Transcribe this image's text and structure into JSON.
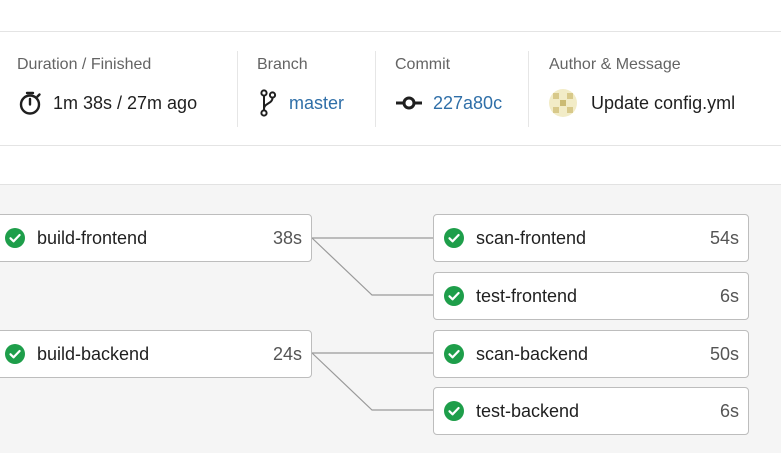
{
  "summary": {
    "duration": {
      "label": "Duration / Finished",
      "value": "1m 38s / 27m ago",
      "icon": "stopwatch-icon"
    },
    "branch": {
      "label": "Branch",
      "value": "master",
      "icon": "branch-icon"
    },
    "commit": {
      "label": "Commit",
      "value": "227a80c",
      "icon": "commit-icon"
    },
    "author": {
      "label": "Author & Message",
      "message": "Update config.yml",
      "icon": "avatar"
    }
  },
  "colors": {
    "link": "#2f6fa8",
    "success": "#1e9e4a",
    "border": "#bdbdbd",
    "graph_bg": "#f5f5f5"
  },
  "stages": [
    {
      "jobs": [
        {
          "name": "build-frontend",
          "duration": "38s",
          "status": "success"
        },
        {
          "name": "build-backend",
          "duration": "24s",
          "status": "success"
        }
      ]
    },
    {
      "jobs": [
        {
          "name": "scan-frontend",
          "duration": "54s",
          "status": "success"
        },
        {
          "name": "test-frontend",
          "duration": "6s",
          "status": "success"
        },
        {
          "name": "scan-backend",
          "duration": "50s",
          "status": "success"
        },
        {
          "name": "test-backend",
          "duration": "6s",
          "status": "success"
        }
      ]
    }
  ]
}
